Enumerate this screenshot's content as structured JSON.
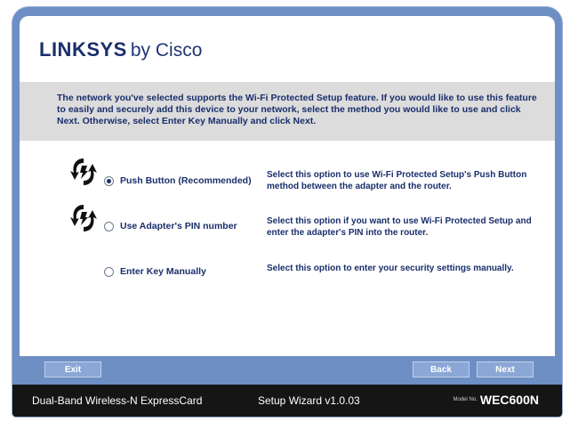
{
  "header": {
    "logo_brand": "LINKSYS",
    "logo_suffix": "by Cisco"
  },
  "intro": {
    "text": "The network you've selected supports the Wi-Fi Protected Setup feature. If you would like to use this feature to easily and securely add this device to your network, select the method you would like to use and click Next. Otherwise, select Enter Key Manually and click Next."
  },
  "options": [
    {
      "label": "Push Button (Recommended)",
      "description": "Select this option to use Wi-Fi Protected Setup's Push Button method between the adapter and the router.",
      "selected": true,
      "icon": "wps-icon"
    },
    {
      "label": "Use Adapter's PIN number",
      "description": "Select this option if you want to use Wi-Fi Protected Setup and enter the adapter's PIN into the router.",
      "selected": false,
      "icon": "wps-icon"
    },
    {
      "label": "Enter Key Manually",
      "description": "Select this option to enter your security settings manually.",
      "selected": false,
      "icon": ""
    }
  ],
  "buttons": {
    "exit": "Exit",
    "back": "Back",
    "next": "Next"
  },
  "footer": {
    "product": "Dual-Band Wireless-N ExpressCard",
    "wizard": "Setup Wizard v1.0.03",
    "model_label": "Model No.",
    "model_number": "WEC600N"
  },
  "colors": {
    "frame": "#6e8fc4",
    "text": "#1a2f6b",
    "intro_bg": "#dcdcdc",
    "footer_bg": "#151515"
  }
}
